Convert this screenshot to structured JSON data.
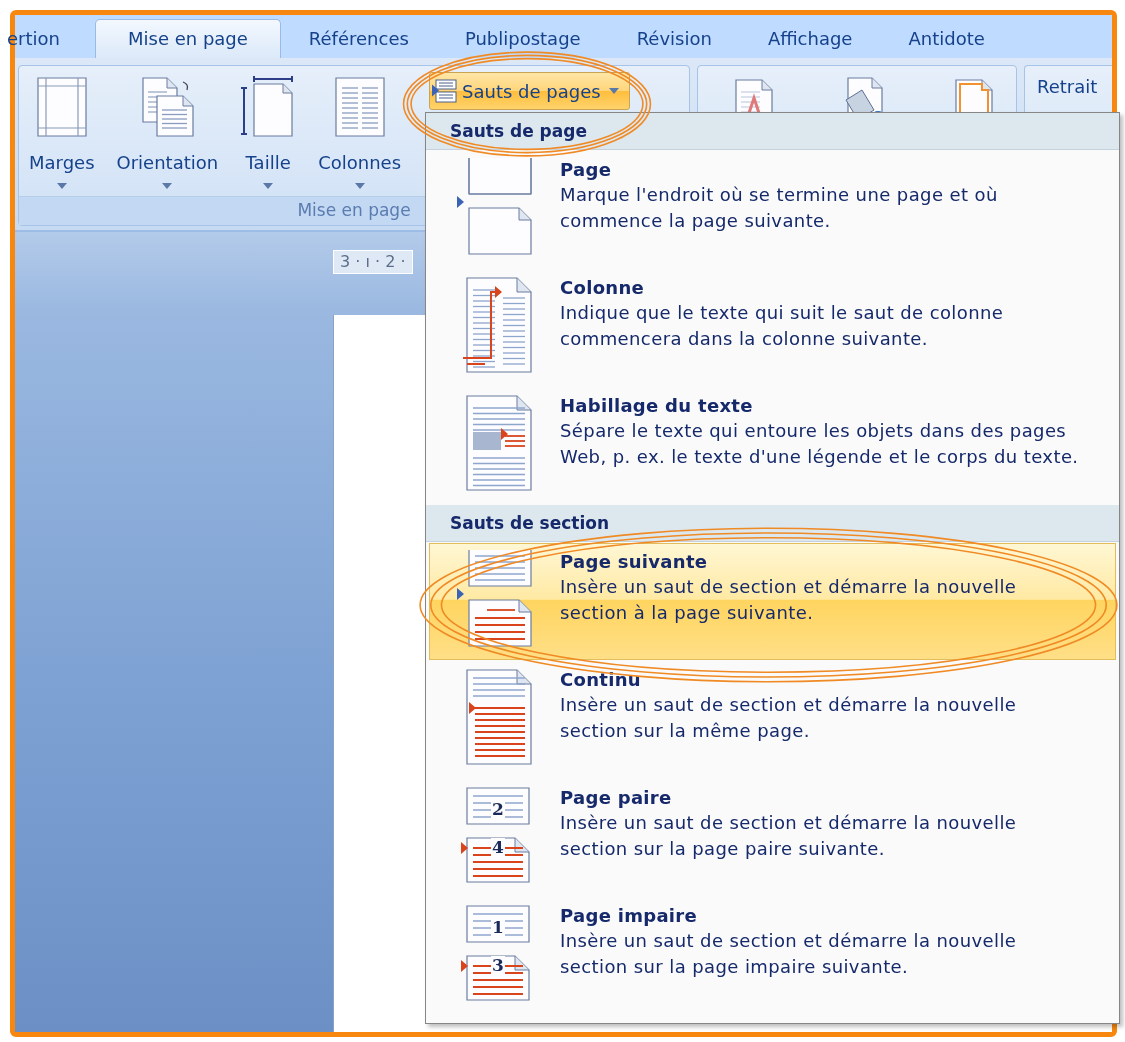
{
  "tabs": [
    {
      "label": "ertion",
      "selected": false
    },
    {
      "label": "Mise en page",
      "selected": true
    },
    {
      "label": "Références",
      "selected": false
    },
    {
      "label": "Publipostage",
      "selected": false
    },
    {
      "label": "Révision",
      "selected": false
    },
    {
      "label": "Affichage",
      "selected": false
    },
    {
      "label": "Antidote",
      "selected": false
    }
  ],
  "ribbon": {
    "groups": [
      {
        "kind": "page_setup",
        "label": "Mise en page",
        "buttons": [
          {
            "kind": "margins",
            "label": "Marges"
          },
          {
            "kind": "orientation",
            "label": "Orientation"
          },
          {
            "kind": "size",
            "label": "Taille"
          },
          {
            "kind": "columns",
            "label": "Colonnes"
          }
        ],
        "breaks_button": {
          "label": "Sauts de pages",
          "open": true,
          "circled": true
        }
      },
      {
        "kind": "background",
        "icons": [
          {
            "kind": "watermark"
          },
          {
            "kind": "page_color"
          },
          {
            "kind": "page_borders"
          }
        ]
      },
      {
        "kind": "paragraph",
        "label": "Retrait"
      }
    ]
  },
  "ruler": {
    "text": "3 · ı · 2 ·"
  },
  "menu": {
    "sections": [
      {
        "header": "Sauts de page",
        "items": [
          {
            "kind": "page",
            "title": "Page",
            "description": "Marque l'endroit où se termine une page et où\ncommence la page suivante.",
            "selected": false,
            "circled": false
          },
          {
            "kind": "column",
            "title": "Colonne",
            "description": "Indique que le texte qui suit le saut de colonne\ncommencera dans la colonne suivante.",
            "selected": false,
            "circled": false
          },
          {
            "kind": "wrap",
            "title": "Habillage du texte",
            "description": "Sépare le texte qui entoure les objets dans des pages\nWeb, p. ex. le texte d'une légende et le corps du texte.",
            "selected": false,
            "circled": false
          }
        ]
      },
      {
        "header": "Sauts de section",
        "items": [
          {
            "kind": "next",
            "title": "Page suivante",
            "description": "Insère un saut de section et démarre la nouvelle\nsection à la page suivante.",
            "selected": true,
            "circled": true
          },
          {
            "kind": "continuous",
            "title": "Continu",
            "description": "Insère un saut de section et démarre la nouvelle\nsection sur la même page.",
            "selected": false,
            "circled": false
          },
          {
            "kind": "numbered",
            "title": "Page paire",
            "description": "Insère un saut de section et démarre la nouvelle\nsection sur la page paire suivante.",
            "selected": false,
            "circled": false,
            "numbers": [
              "2",
              "4"
            ]
          },
          {
            "kind": "numbered",
            "title": "Page impaire",
            "description": "Insère un saut de section et démarre la nouvelle\nsection sur la page impaire suivante.",
            "selected": false,
            "circled": false,
            "numbers": [
              "1",
              "3"
            ]
          }
        ]
      }
    ]
  }
}
